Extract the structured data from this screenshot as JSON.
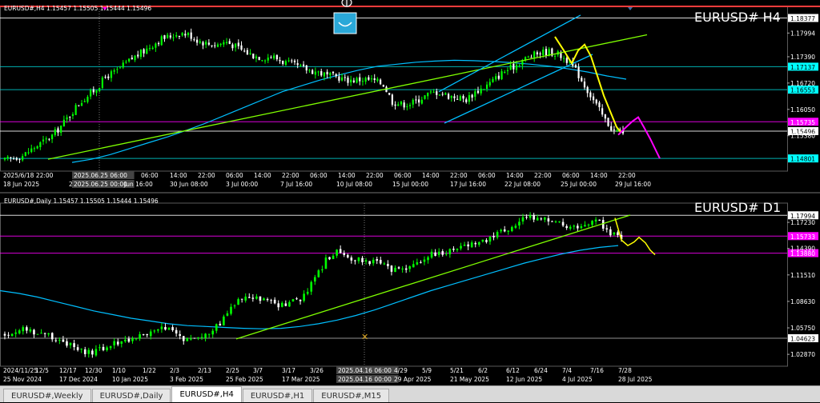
{
  "colors": {
    "bull": "#00ff00",
    "bear": "#ffffff",
    "ma": "#00bfff",
    "trend": "#7fff00",
    "forecast_h4": "#ffff00",
    "forecast_d1": "#ffff00",
    "future": "#ff00ff",
    "hline_cyan": "#00ced1",
    "hline_magenta": "#ff00ff",
    "grid": "#333333"
  },
  "top": {
    "header": "EURUSD#,H4  1.15457 1.15505 1.15444 1.15496",
    "label": "EURUSD# H4",
    "price_min": 1.146,
    "price_max": 1.1855,
    "price_ticks": [
      "1.17994",
      "1.17390",
      "1.16720",
      "1.16050",
      "1.15380"
    ],
    "price_tick_vals": [
      1.17994,
      1.1739,
      1.1672,
      1.1605,
      1.1538
    ],
    "levels": [
      {
        "text": "1.18377",
        "value": 1.18377,
        "color": "#ffffff",
        "box": "#ffffff",
        "fg": "#000000"
      },
      {
        "text": "1.17137",
        "value": 1.17137,
        "color": "#00ced1",
        "box": "#00ffff",
        "fg": "#000000"
      },
      {
        "text": "1.16553",
        "value": 1.16553,
        "color": "#00ced1",
        "box": "#00ffff",
        "fg": "#000000"
      },
      {
        "text": "1.15735",
        "value": 1.15735,
        "color": "#ff00ff",
        "box": "#ff00ff",
        "fg": "#ffffff"
      },
      {
        "text": "1.15496",
        "value": 1.15496,
        "color": "#ffffff",
        "box": "#ffffff",
        "fg": "#000000"
      },
      {
        "text": "1.14801",
        "value": 1.14801,
        "color": "#00ced1",
        "box": "#00ffff",
        "fg": "#000000"
      }
    ],
    "time_row1": [
      {
        "t": "2025/6/18 22:00",
        "x": 4
      },
      {
        "t": "2025.06.25 06:00",
        "x": 92,
        "hl": true
      },
      {
        "t": "06:00",
        "x": 176
      },
      {
        "t": "14:00",
        "x": 212
      },
      {
        "t": "22:00",
        "x": 247
      },
      {
        "t": "06:00",
        "x": 282
      },
      {
        "t": "14:00",
        "x": 317
      },
      {
        "t": "22:00",
        "x": 352
      },
      {
        "t": "06:00",
        "x": 387
      },
      {
        "t": "14:00",
        "x": 422
      },
      {
        "t": "22:00",
        "x": 457
      },
      {
        "t": "06:00",
        "x": 492
      },
      {
        "t": "14:00",
        "x": 527
      },
      {
        "t": "22:00",
        "x": 562
      },
      {
        "t": "06:00",
        "x": 597
      },
      {
        "t": "14:00",
        "x": 632
      },
      {
        "t": "22:00",
        "x": 667
      },
      {
        "t": "06:00",
        "x": 702
      },
      {
        "t": "14:00",
        "x": 737
      },
      {
        "t": "22:00",
        "x": 772
      }
    ],
    "time_row2": [
      {
        "t": "18 Jun 2025",
        "x": 4
      },
      {
        "t": "23 Jul",
        "x": 86
      },
      {
        "t": "2025.06.25 00:00",
        "x": 92,
        "hl": true
      },
      {
        "t": "Jun 16:00",
        "x": 155
      },
      {
        "t": "30 Jun 08:00",
        "x": 212
      },
      {
        "t": "3 Jul 00:00",
        "x": 282
      },
      {
        "t": "7 Jul 16:00",
        "x": 350
      },
      {
        "t": "10 Jul 08:00",
        "x": 420
      },
      {
        "t": "15 Jul 00:00",
        "x": 490
      },
      {
        "t": "17 Jul 16:00",
        "x": 562
      },
      {
        "t": "22 Jul 08:00",
        "x": 630
      },
      {
        "t": "25 Jul 00:00",
        "x": 700
      },
      {
        "t": "29 Jul 16:00",
        "x": 768
      }
    ]
  },
  "bottom": {
    "header": "EURUSD#,Daily  1.15457 1.15505 1.15444 1.15496",
    "label": "EURUSD# D1",
    "price_min": 1.021,
    "price_max": 1.188,
    "price_ticks": [
      "1.17230",
      "1.14390",
      "1.11510",
      "1.08630",
      "1.05750",
      "1.02870"
    ],
    "price_tick_vals": [
      1.1723,
      1.1439,
      1.1151,
      1.0863,
      1.0575,
      1.0287
    ],
    "levels": [
      {
        "text": "1.17994",
        "value": 1.17994,
        "color": "#ffffff",
        "box": "#ffffff",
        "fg": "#000000"
      },
      {
        "text": "1.15733",
        "value": 1.15733,
        "color": "#ff00ff",
        "box": "#ff00ff",
        "fg": "#ffffff"
      },
      {
        "text": "1.13880",
        "value": 1.1388,
        "color": "#ff00ff",
        "box": "#ff00ff",
        "fg": "#ffffff"
      },
      {
        "text": "1.04623",
        "value": 1.04623,
        "color": "#aaaaaa",
        "box": "#ffffff",
        "fg": "#000000"
      }
    ],
    "time_row1": [
      {
        "t": "2024/11/25",
        "x": 4
      },
      {
        "t": "12/5",
        "x": 44
      },
      {
        "t": "12/17",
        "x": 74
      },
      {
        "t": "12/30",
        "x": 106
      },
      {
        "t": "1/10",
        "x": 140
      },
      {
        "t": "1/22",
        "x": 178
      },
      {
        "t": "2/3",
        "x": 212
      },
      {
        "t": "2/13",
        "x": 247
      },
      {
        "t": "2/25",
        "x": 282
      },
      {
        "t": "3/7",
        "x": 316
      },
      {
        "t": "3/17",
        "x": 352
      },
      {
        "t": "3/26",
        "x": 387
      },
      {
        "t": "2025.04.16 06:00",
        "x": 422,
        "hl": true
      },
      {
        "t": "4/29",
        "x": 492
      },
      {
        "t": "5/9",
        "x": 527
      },
      {
        "t": "5/21",
        "x": 562
      },
      {
        "t": "6/2",
        "x": 597
      },
      {
        "t": "6/12",
        "x": 632
      },
      {
        "t": "6/24",
        "x": 667
      },
      {
        "t": "7/4",
        "x": 702
      },
      {
        "t": "7/16",
        "x": 737
      },
      {
        "t": "7/28",
        "x": 772
      }
    ],
    "time_row2": [
      {
        "t": "25 Nov 2024",
        "x": 4
      },
      {
        "t": "17 Dec 2024",
        "x": 74
      },
      {
        "t": "10 Jan 2025",
        "x": 140
      },
      {
        "t": "3 Feb 2025",
        "x": 212
      },
      {
        "t": "25 Feb 2025",
        "x": 282
      },
      {
        "t": "17 Mar 2025",
        "x": 352
      },
      {
        "t": "2025.04.16 00:00",
        "x": 422,
        "hl": true
      },
      {
        "t": "29 Apr 2025",
        "x": 492
      },
      {
        "t": "21 May 2025",
        "x": 562
      },
      {
        "t": "12 Jun 2025",
        "x": 632
      },
      {
        "t": "4 Jul 2025",
        "x": 702
      },
      {
        "t": "28 Jul 2025",
        "x": 772
      }
    ]
  },
  "tabs": [
    "EURUSD#,Weekly",
    "EURUSD#,Daily",
    "EURUSD#,H4",
    "EURUSD#,H1",
    "EURUSD#,M15"
  ],
  "active_tab": 2,
  "chart_data": [
    {
      "type": "candlestick",
      "title": "EURUSD# H4",
      "timeframe": "H4",
      "ohlc_header": [
        1.15457,
        1.15505,
        1.15444,
        1.15496
      ],
      "ylim": [
        1.146,
        1.1855
      ],
      "close_path": [
        1.1475,
        1.1482,
        1.1488,
        1.1505,
        1.152,
        1.1535,
        1.156,
        1.159,
        1.162,
        1.164,
        1.166,
        1.169,
        1.17,
        1.172,
        1.1738,
        1.1752,
        1.177,
        1.1785,
        1.1792,
        1.18,
        1.1795,
        1.178,
        1.1772,
        1.177,
        1.1778,
        1.1765,
        1.1752,
        1.1742,
        1.1737,
        1.174,
        1.1728,
        1.172,
        1.1712,
        1.1705,
        1.17,
        1.169,
        1.1688,
        1.168,
        1.168,
        1.1682,
        1.1678,
        1.167,
        1.1625,
        1.1618,
        1.162,
        1.1632,
        1.1645,
        1.165,
        1.164,
        1.1636,
        1.163,
        1.165,
        1.1662,
        1.168,
        1.17,
        1.1712,
        1.173,
        1.174,
        1.175,
        1.1752,
        1.1745,
        1.173,
        1.17,
        1.166,
        1.162,
        1.158,
        1.155,
        1.1549
      ],
      "moving_average": [
        1.147,
        1.1478,
        1.149,
        1.1505,
        1.152,
        1.1535,
        1.1552,
        1.157,
        1.159,
        1.161,
        1.163,
        1.165,
        1.1665,
        1.168,
        1.1693,
        1.1705,
        1.1715,
        1.172,
        1.1725,
        1.1728,
        1.173,
        1.1729,
        1.1727,
        1.1724,
        1.172,
        1.1715,
        1.1708,
        1.17,
        1.169,
        1.1682
      ],
      "forecast_yellow": [
        [
          693,
          1.179
        ],
        [
          705,
          1.1752
        ],
        [
          714,
          1.1722
        ],
        [
          722,
          1.1755
        ],
        [
          730,
          1.177
        ],
        [
          738,
          1.174
        ],
        [
          746,
          1.169
        ],
        [
          754,
          1.164
        ],
        [
          762,
          1.16
        ],
        [
          770,
          1.156
        ],
        [
          775,
          1.1548
        ]
      ],
      "future_magenta": [
        [
          772,
          1.154
        ],
        [
          782,
          1.156
        ],
        [
          790,
          1.1575
        ],
        [
          797,
          1.1585
        ],
        [
          804,
          1.156
        ],
        [
          812,
          1.153
        ],
        [
          818,
          1.1505
        ],
        [
          824,
          1.148
        ]
      ],
      "trend_lines": [
        [
          [
            60,
            1.1478
          ],
          [
            808,
            1.1795
          ]
        ],
        [
          [
            548,
            1.165
          ],
          [
            725,
            1.1845
          ]
        ],
        [
          [
            555,
            1.157
          ],
          [
            740,
            1.1745
          ]
        ]
      ],
      "levels": [
        1.18377,
        1.17137,
        1.16553,
        1.15735,
        1.15496,
        1.14801
      ]
    },
    {
      "type": "candlestick",
      "title": "EURUSD# D1",
      "timeframe": "D1",
      "ohlc_header": [
        1.15457,
        1.15505,
        1.15444,
        1.15496
      ],
      "ylim": [
        1.021,
        1.188
      ],
      "close_path": [
        1.05,
        1.053,
        1.056,
        1.055,
        1.052,
        1.05,
        1.048,
        1.043,
        1.038,
        1.032,
        1.03,
        1.031,
        1.035,
        1.04,
        1.042,
        1.045,
        1.048,
        1.05,
        1.052,
        1.056,
        1.055,
        1.05,
        1.045,
        1.047,
        1.05,
        1.053,
        1.06,
        1.072,
        1.085,
        1.088,
        1.09,
        1.088,
        1.086,
        1.083,
        1.082,
        1.086,
        1.09,
        1.1,
        1.115,
        1.13,
        1.14,
        1.138,
        1.134,
        1.132,
        1.13,
        1.131,
        1.125,
        1.12,
        1.119,
        1.123,
        1.128,
        1.132,
        1.138,
        1.14,
        1.141,
        1.145,
        1.148,
        1.15,
        1.152,
        1.155,
        1.16,
        1.165,
        1.17,
        1.175,
        1.178,
        1.176,
        1.174,
        1.172,
        1.169,
        1.166,
        1.169,
        1.172,
        1.174,
        1.165,
        1.159,
        1.155
      ],
      "moving_average": [
        1.098,
        1.095,
        1.091,
        1.086,
        1.081,
        1.076,
        1.072,
        1.068,
        1.065,
        1.062,
        1.06,
        1.059,
        1.058,
        1.057,
        1.0565,
        1.057,
        1.059,
        1.062,
        1.066,
        1.071,
        1.077,
        1.084,
        1.091,
        1.098,
        1.104,
        1.11,
        1.116,
        1.122,
        1.128,
        1.133,
        1.138,
        1.142,
        1.145,
        1.147
      ],
      "forecast_yellow": [
        [
          768,
          1.177
        ],
        [
          776,
          1.153
        ],
        [
          784,
          1.147
        ],
        [
          792,
          1.151
        ],
        [
          798,
          1.156
        ],
        [
          806,
          1.15
        ],
        [
          812,
          1.142
        ],
        [
          818,
          1.137
        ]
      ],
      "trend_lines": [
        [
          [
            295,
            1.0455
          ],
          [
            787,
            1.1802
          ]
        ]
      ],
      "levels": [
        1.17994,
        1.15733,
        1.1388,
        1.04623
      ]
    }
  ]
}
